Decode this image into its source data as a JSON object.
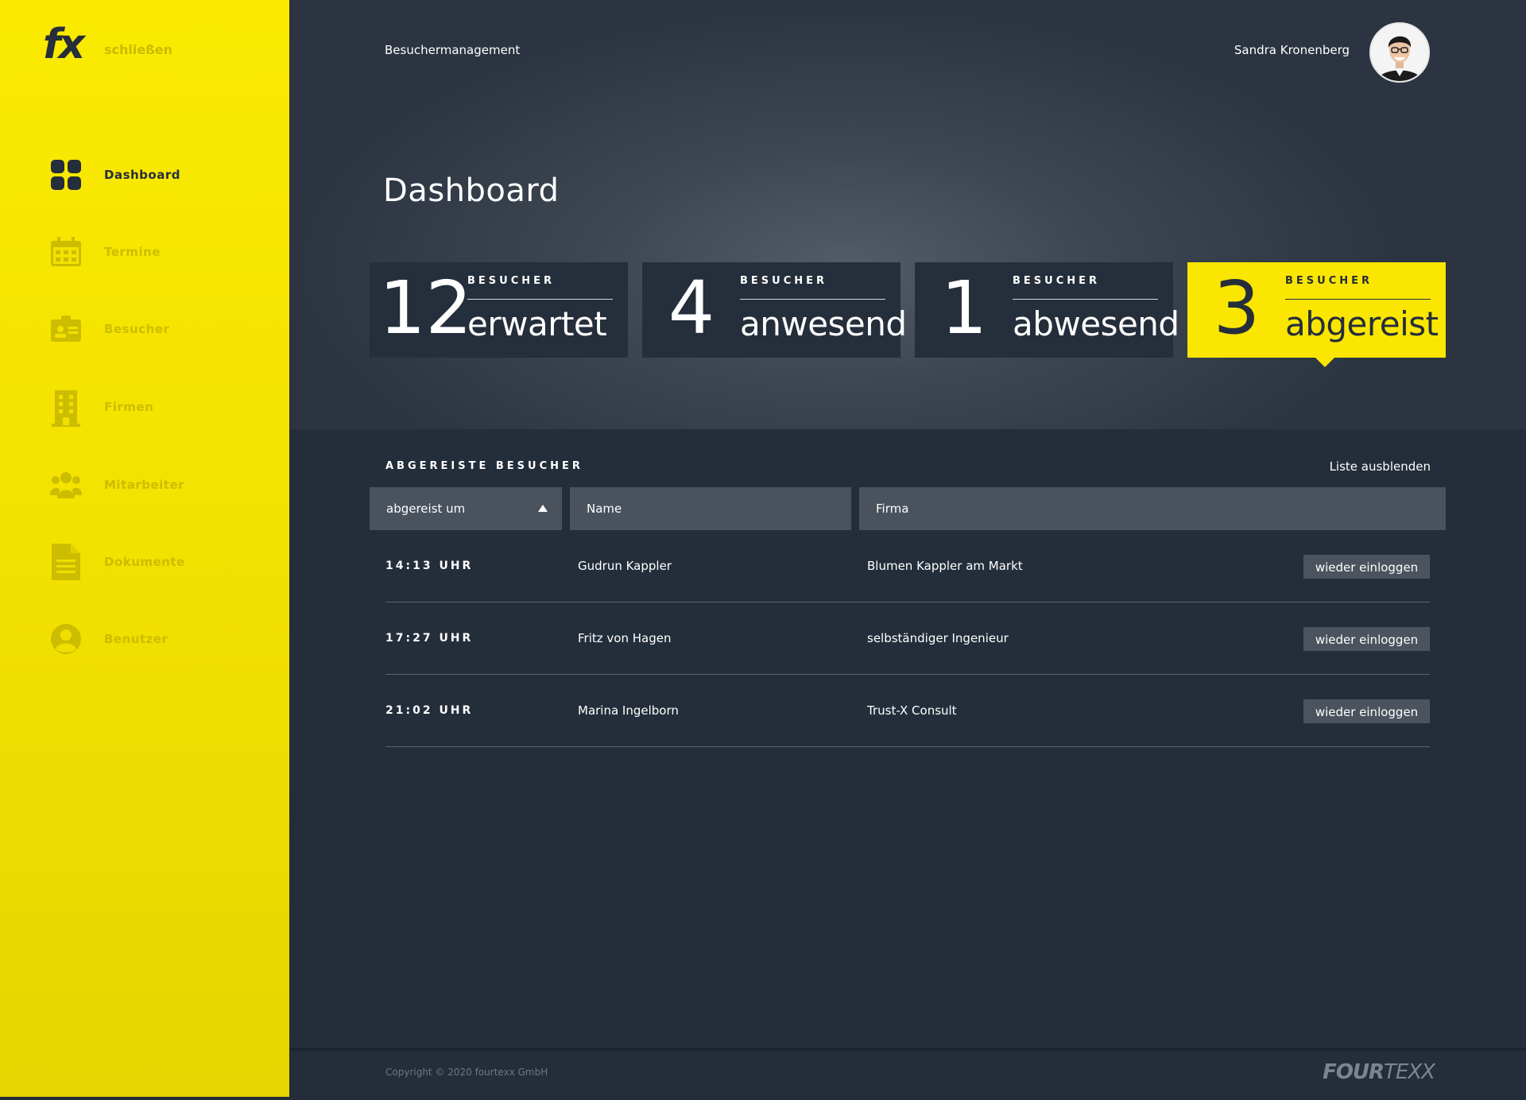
{
  "sidebar": {
    "logo": "fx",
    "close_label": "schließen",
    "items": [
      {
        "label": "Dashboard",
        "icon": "dashboard-icon",
        "active": true
      },
      {
        "label": "Termine",
        "icon": "calendar-icon"
      },
      {
        "label": "Besucher",
        "icon": "visitor-badge-icon"
      },
      {
        "label": "Firmen",
        "icon": "building-icon"
      },
      {
        "label": "Mitarbeiter",
        "icon": "team-icon"
      },
      {
        "label": "Dokumente",
        "icon": "document-icon"
      },
      {
        "label": "Benutzer",
        "icon": "user-icon"
      }
    ]
  },
  "header": {
    "app_title": "Besuchermanagement",
    "user_name": "Sandra Kronenberg"
  },
  "page": {
    "title": "Dashboard"
  },
  "stats": [
    {
      "count": "12",
      "kicker": "BESUCHER",
      "label": "erwartet"
    },
    {
      "count": "4",
      "kicker": "BESUCHER",
      "label": "anwesend"
    },
    {
      "count": "1",
      "kicker": "BESUCHER",
      "label": "abwesend"
    },
    {
      "count": "3",
      "kicker": "BESUCHER",
      "label": "abgereist",
      "active": true
    }
  ],
  "table": {
    "title": "ABGEREISTE BESUCHER",
    "hide_label": "Liste ausblenden",
    "columns": [
      "abgereist um",
      "Name",
      "Firma"
    ],
    "rows": [
      {
        "time": "14:13 UHR",
        "name": "Gudrun Kappler",
        "company": "Blumen Kappler am Markt",
        "action": "wieder einloggen"
      },
      {
        "time": "17:27 UHR",
        "name": "Fritz von Hagen",
        "company": "selbständiger Ingenieur",
        "action": "wieder einloggen"
      },
      {
        "time": "21:02 UHR",
        "name": "Marina Ingelborn",
        "company": "Trust-X Consult",
        "action": "wieder einloggen"
      }
    ]
  },
  "footer": {
    "copyright": "Copyright © 2020 fourtexx GmbH",
    "brand_bold": "FOUR",
    "brand_thin": "TEXX"
  },
  "colors": {
    "accent": "#fae600",
    "dark": "#252e3a",
    "panel": "#242e3b",
    "header_cell": "#4a525d"
  }
}
